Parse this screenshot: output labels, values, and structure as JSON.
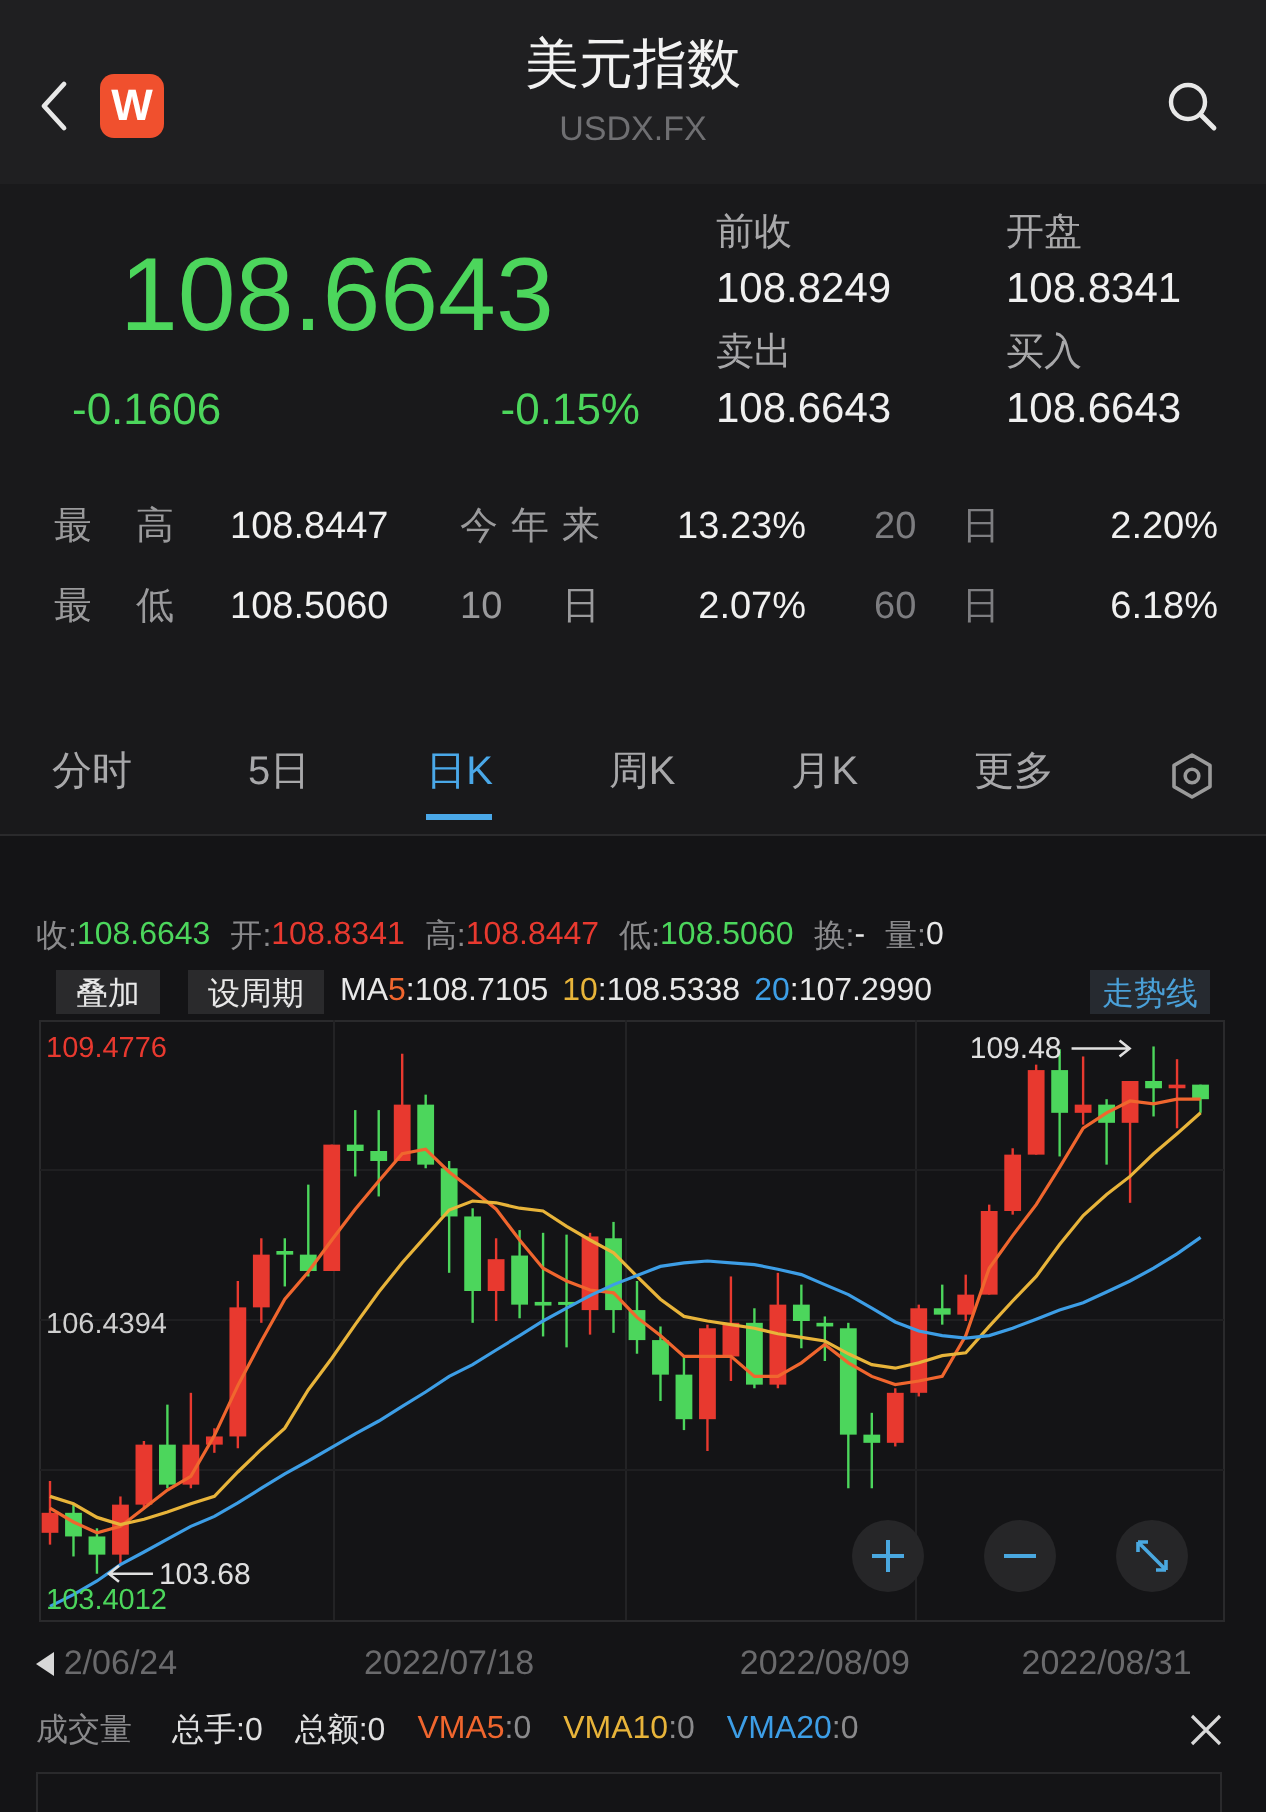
{
  "header": {
    "logo_text": "W",
    "title": "美元指数",
    "subtitle": "USDX.FX"
  },
  "quote": {
    "price": "108.6643",
    "change": "-0.1606",
    "change_pct": "-0.15%",
    "color": "#4cd65c",
    "details": [
      {
        "label": "前收",
        "value": "108.8249"
      },
      {
        "label": "开盘",
        "value": "108.8341"
      },
      {
        "label": "卖出",
        "value": "108.6643"
      },
      {
        "label": "买入",
        "value": "108.6643"
      }
    ],
    "stats": [
      [
        {
          "label": "最 高",
          "value": "108.8447"
        },
        {
          "label": "今年来",
          "value": "13.23%"
        },
        {
          "label": "20 日",
          "value": "2.20%"
        }
      ],
      [
        {
          "label": "最 低",
          "value": "108.5060"
        },
        {
          "label": "10 日",
          "value": "2.07%"
        },
        {
          "label": "60 日",
          "value": "6.18%"
        }
      ]
    ]
  },
  "tabs": [
    {
      "label": "分时",
      "selected": false
    },
    {
      "label": "5日",
      "selected": false
    },
    {
      "label": "日K",
      "selected": true
    },
    {
      "label": "周K",
      "selected": false
    },
    {
      "label": "月K",
      "selected": false
    },
    {
      "label": "更多",
      "selected": false
    }
  ],
  "quote_bar": [
    {
      "label": "收:",
      "value": "108.6643",
      "color": "#4cd65c"
    },
    {
      "label": "开:",
      "value": "108.8341",
      "color": "#e8392f"
    },
    {
      "label": "高:",
      "value": "108.8447",
      "color": "#e8392f"
    },
    {
      "label": "低:",
      "value": "108.5060",
      "color": "#4cd65c"
    },
    {
      "label": "换:",
      "value": "-",
      "color": "#e8e8e8"
    },
    {
      "label": "量:",
      "value": "0",
      "color": "#e8e8e8"
    }
  ],
  "toolbar": {
    "buttons": [
      "叠加",
      "设周期"
    ],
    "legend": [
      {
        "prefix": "MA",
        "period": "5",
        "value": ":108.7105",
        "color": "#f0662e"
      },
      {
        "period": "10",
        "value": ":108.5338",
        "color": "#e8b43a"
      },
      {
        "period": "20",
        "value": ":107.2990",
        "color": "#3d9ee6"
      }
    ],
    "trend_button": "走势线"
  },
  "chart": {
    "chart_data": {
      "type": "candlestick",
      "ylim": [
        103.16,
        109.76
      ],
      "yticks": [
        {
          "value": 109.4776,
          "label": "109.4776"
        },
        {
          "value": 106.4394,
          "label": "106.4394"
        },
        {
          "value": 103.4012,
          "label": "103.4012"
        }
      ],
      "categories": [
        null,
        null,
        null,
        "2/06/24",
        null,
        null,
        null,
        null,
        null,
        null,
        null,
        null,
        null,
        null,
        null,
        null,
        null,
        "2022/07/18",
        null,
        null,
        null,
        null,
        null,
        null,
        null,
        null,
        null,
        null,
        null,
        null,
        null,
        null,
        null,
        "2022/08/09",
        null,
        null,
        null,
        null,
        null,
        null,
        null,
        null,
        null,
        null,
        null,
        "2022/08/31",
        null,
        null,
        null,
        null
      ],
      "ohlc": [
        [
          104.13,
          104.7,
          104.0,
          104.35
        ],
        [
          104.35,
          104.44,
          103.87,
          104.09
        ],
        [
          104.09,
          104.18,
          103.68,
          103.89
        ],
        [
          103.89,
          104.53,
          103.78,
          104.44
        ],
        [
          104.44,
          105.14,
          104.4,
          105.1
        ],
        [
          105.1,
          105.54,
          104.62,
          104.66
        ],
        [
          104.66,
          105.67,
          104.62,
          105.1
        ],
        [
          105.1,
          105.28,
          105.01,
          105.19
        ],
        [
          105.19,
          106.9,
          105.06,
          106.61
        ],
        [
          106.61,
          107.37,
          106.44,
          107.19
        ],
        [
          107.23,
          107.37,
          106.84,
          107.19
        ],
        [
          107.19,
          107.96,
          106.95,
          107.01
        ],
        [
          107.01,
          108.4,
          107.01,
          108.4
        ],
        [
          108.4,
          108.78,
          108.05,
          108.33
        ],
        [
          108.33,
          108.78,
          107.83,
          108.22
        ],
        [
          108.22,
          109.4,
          108.22,
          108.84
        ],
        [
          108.84,
          108.95,
          108.14,
          108.18
        ],
        [
          108.14,
          108.22,
          106.99,
          107.61
        ],
        [
          107.61,
          107.7,
          106.44,
          106.79
        ],
        [
          106.79,
          107.37,
          106.46,
          107.14
        ],
        [
          107.18,
          107.46,
          106.49,
          106.64
        ],
        [
          106.67,
          107.43,
          106.29,
          106.63
        ],
        [
          106.67,
          107.41,
          106.17,
          106.65
        ],
        [
          106.58,
          107.43,
          106.31,
          107.39
        ],
        [
          107.37,
          107.55,
          106.33,
          106.58
        ],
        [
          106.58,
          106.9,
          106.1,
          106.25
        ],
        [
          106.25,
          106.4,
          105.58,
          105.87
        ],
        [
          105.87,
          106.07,
          105.26,
          105.38
        ],
        [
          105.38,
          106.42,
          105.03,
          106.38
        ],
        [
          106.07,
          106.95,
          105.8,
          106.44
        ],
        [
          106.44,
          106.6,
          105.72,
          105.76
        ],
        [
          105.76,
          106.99,
          105.72,
          106.64
        ],
        [
          106.64,
          106.86,
          106.16,
          106.46
        ],
        [
          106.44,
          106.51,
          106.02,
          106.4
        ],
        [
          106.38,
          106.44,
          104.62,
          105.21
        ],
        [
          105.21,
          105.45,
          104.62,
          105.12
        ],
        [
          105.12,
          105.72,
          105.08,
          105.67
        ],
        [
          105.67,
          106.64,
          105.63,
          106.6
        ],
        [
          106.6,
          106.86,
          106.42,
          106.53
        ],
        [
          106.53,
          106.97,
          106.46,
          106.75
        ],
        [
          106.75,
          107.74,
          106.75,
          107.67
        ],
        [
          107.67,
          108.36,
          107.63,
          108.29
        ],
        [
          108.29,
          109.28,
          108.29,
          109.22
        ],
        [
          109.22,
          109.45,
          108.27,
          108.75
        ],
        [
          108.75,
          109.37,
          108.62,
          108.84
        ],
        [
          108.84,
          108.9,
          108.18,
          108.64
        ],
        [
          108.64,
          109.1,
          107.76,
          109.1
        ],
        [
          109.1,
          109.48,
          108.71,
          109.02
        ],
        [
          109.02,
          109.34,
          108.58,
          109.06
        ],
        [
          109.06,
          109.06,
          108.75,
          108.9
        ]
      ],
      "series": [
        {
          "type": "line",
          "color": "#f0662e",
          "values": [
            104.4,
            104.25,
            104.13,
            104.2,
            104.4,
            104.6,
            104.75,
            105.2,
            105.75,
            106.24,
            106.7,
            107.0,
            107.35,
            107.69,
            108.0,
            108.3,
            108.35,
            108.1,
            107.9,
            107.69,
            107.35,
            107.04,
            106.9,
            106.8,
            106.77,
            106.5,
            106.3,
            106.07,
            106.07,
            106.07,
            105.85,
            105.85,
            106.0,
            106.2,
            106.0,
            105.85,
            105.76,
            105.8,
            105.85,
            106.3,
            107.04,
            107.4,
            107.74,
            108.15,
            108.58,
            108.75,
            108.88,
            108.85,
            108.9,
            108.9
          ]
        },
        {
          "type": "line",
          "color": "#e8b43a",
          "values": [
            104.53,
            104.45,
            104.3,
            104.22,
            104.28,
            104.36,
            104.45,
            104.53,
            104.8,
            105.05,
            105.28,
            105.7,
            106.05,
            106.42,
            106.78,
            107.1,
            107.39,
            107.68,
            107.78,
            107.76,
            107.7,
            107.67,
            107.5,
            107.35,
            107.21,
            106.95,
            106.7,
            106.51,
            106.46,
            106.42,
            106.38,
            106.32,
            106.28,
            106.24,
            106.1,
            105.98,
            105.94,
            106.0,
            106.08,
            106.11,
            106.4,
            106.68,
            106.95,
            107.3,
            107.62,
            107.85,
            108.05,
            108.3,
            108.52,
            108.75
          ]
        },
        {
          "type": "line",
          "color": "#3d9ee6",
          "values": [
            103.32,
            103.45,
            103.6,
            103.78,
            103.92,
            104.06,
            104.2,
            104.31,
            104.46,
            104.62,
            104.78,
            104.92,
            105.07,
            105.22,
            105.36,
            105.52,
            105.68,
            105.85,
            105.98,
            106.14,
            106.3,
            106.46,
            106.6,
            106.74,
            106.86,
            106.96,
            107.06,
            107.1,
            107.12,
            107.1,
            107.08,
            107.03,
            106.97,
            106.86,
            106.75,
            106.6,
            106.45,
            106.35,
            106.3,
            106.27,
            106.3,
            106.38,
            106.48,
            106.58,
            106.66,
            106.78,
            106.9,
            107.04,
            107.2,
            107.38
          ]
        }
      ],
      "annotations": [
        "109.48",
        "103.68"
      ]
    }
  },
  "volume": {
    "title": "成交量",
    "items": [
      {
        "label": "总手:",
        "value": "0"
      },
      {
        "label": "总额:",
        "value": "0"
      }
    ],
    "vma": [
      {
        "name": "VMA5",
        "value": ":0",
        "color": "#f0662e"
      },
      {
        "name": "VMA10",
        "value": ":0",
        "color": "#e8b43a"
      },
      {
        "name": "VMA20",
        "value": ":0",
        "color": "#3d9ee6"
      }
    ]
  }
}
